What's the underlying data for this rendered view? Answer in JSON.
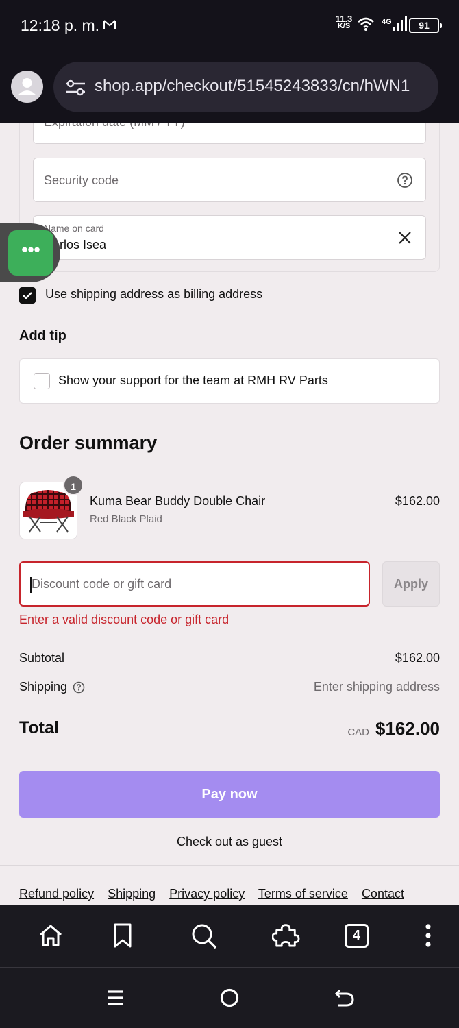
{
  "status_bar": {
    "time": "12:18 p. m.",
    "speed_value": "11.3",
    "speed_unit": "K/S",
    "network": "4G",
    "battery": "91"
  },
  "browser": {
    "url": "shop.app/checkout/51545243833/cn/hWN1"
  },
  "payment": {
    "expiration_placeholder": "Expiration date (MM / YY)",
    "security_placeholder": "Security code",
    "name_label": "Name on card",
    "name_value": "Carlos Isea",
    "billing_label": "Use shipping address as billing address",
    "billing_checked": true
  },
  "tip": {
    "heading": "Add tip",
    "label": "Show your support for the team at RMH RV Parts"
  },
  "summary": {
    "heading": "Order summary",
    "item": {
      "name": "Kuma Bear Buddy Double Chair",
      "variant": "Red Black Plaid",
      "price": "$162.00",
      "quantity": "1"
    },
    "discount_placeholder": "Discount code or gift card",
    "apply_label": "Apply",
    "discount_error": "Enter a valid discount code or gift card",
    "subtotal_label": "Subtotal",
    "subtotal_value": "$162.00",
    "shipping_label": "Shipping",
    "shipping_value": "Enter shipping address",
    "total_label": "Total",
    "total_currency": "CAD",
    "total_value": "$162.00"
  },
  "actions": {
    "pay_label": "Pay now",
    "guest_label": "Check out as guest"
  },
  "footer": {
    "links": [
      "Refund policy",
      "Shipping",
      "Privacy policy",
      "Terms of service",
      "Contact"
    ]
  },
  "bubble": {
    "label": "•••"
  },
  "browser_bar": {
    "tab_count": "4"
  },
  "colors": {
    "accent": "#a48cf0",
    "error": "#c7242c",
    "page_bg": "#f1ecee"
  }
}
